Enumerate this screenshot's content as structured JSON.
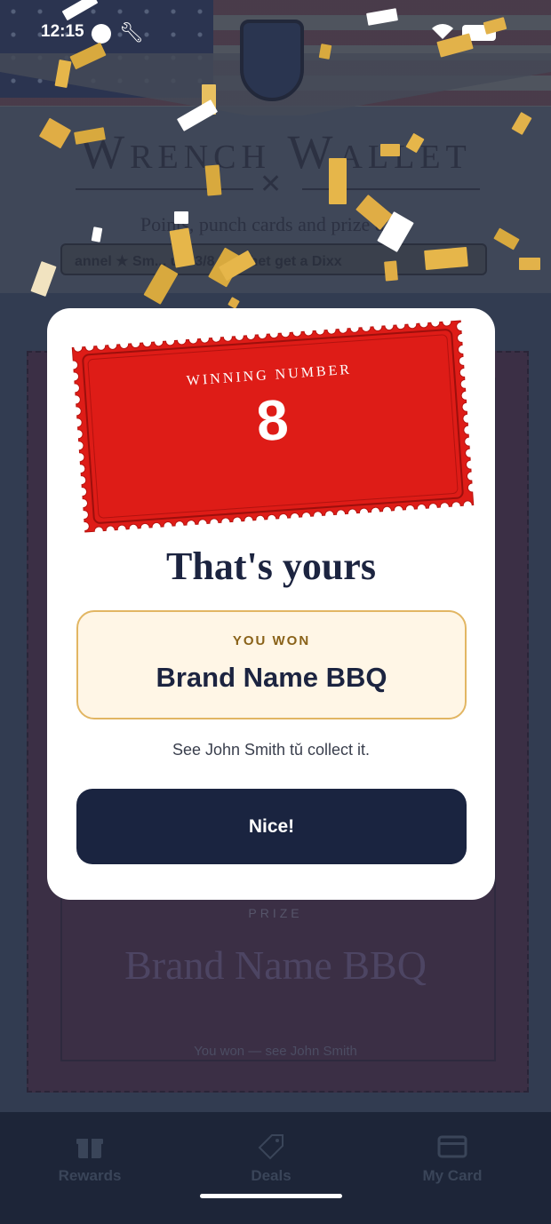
{
  "status_bar": {
    "time": "12:15"
  },
  "background": {
    "app_title": "Wrench Wallet",
    "tagline": "Points, punch cards and prize days",
    "ticker": "annel  ★  Sm... u a 3/8 Ratchet get a Dixx",
    "prize_label": "PRIZE",
    "prize_name": "Brand Name BBQ",
    "prize_note": "You won — see John Smith"
  },
  "modal": {
    "ticket_label": "WINNING NUMBER",
    "winning_number": "8",
    "heading": "That's yours",
    "won_label": "YOU WON",
    "won_prize": "Brand Name BBQ",
    "collect_note": "See John Smith tǔ collect it.",
    "button_label": "Nice!"
  },
  "bottom_nav": {
    "items": [
      {
        "label": "Rewards",
        "icon": "gift-icon"
      },
      {
        "label": "Deals",
        "icon": "tag-icon"
      },
      {
        "label": "My Card",
        "icon": "card-icon"
      }
    ]
  },
  "colors": {
    "ticket_red": "#de1c17",
    "navy": "#1a2440",
    "gold_border": "#e2b663",
    "gold_fill": "#fff6e6"
  }
}
